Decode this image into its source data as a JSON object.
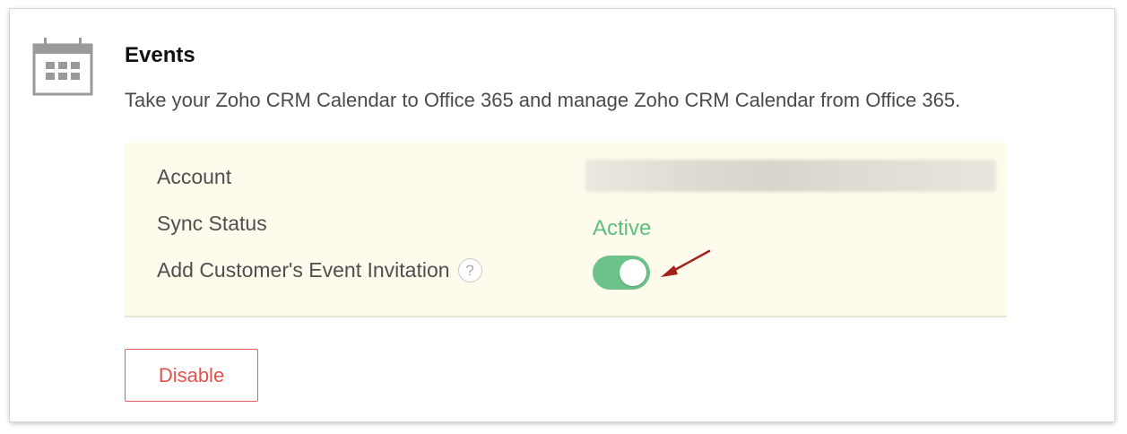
{
  "section": {
    "icon": "calendar-icon",
    "title": "Events",
    "description": "Take your Zoho CRM Calendar to Office 365 and manage Zoho CRM Calendar from Office 365."
  },
  "details": {
    "account_label": "Account",
    "sync_status_label": "Sync Status",
    "sync_status_value": "Active",
    "invitation_label": "Add Customer's Event Invitation",
    "help_icon": "?",
    "invitation_enabled": true
  },
  "actions": {
    "disable_label": "Disable"
  },
  "colors": {
    "active_green": "#5cbf7d",
    "toggle_green": "#6cc389",
    "disable_red": "#e2524f",
    "panel_bg": "#fefbec",
    "annotation_arrow": "#a3201c"
  }
}
